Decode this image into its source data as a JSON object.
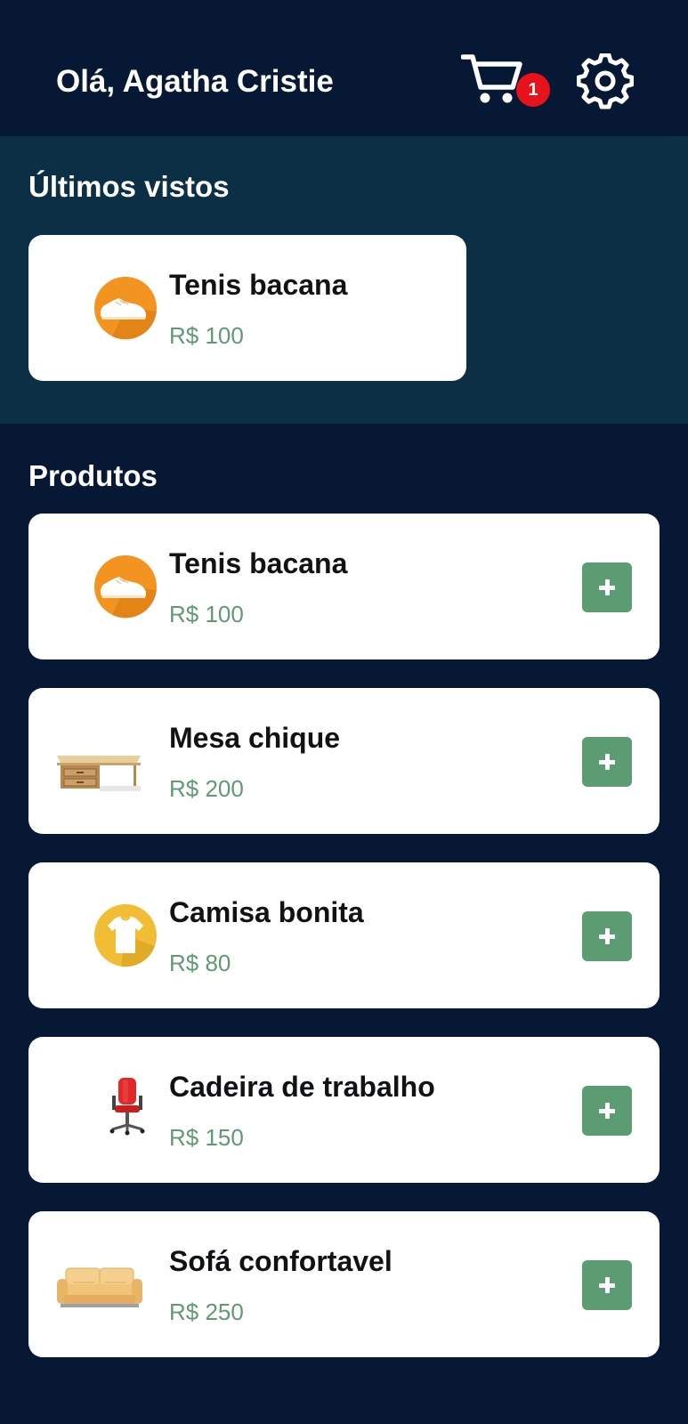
{
  "header": {
    "greeting": "Olá, Agatha Cristie",
    "cart_count": "1",
    "cart_icon": "cart-icon",
    "settings_icon": "gear-icon"
  },
  "recent": {
    "title": "Últimos vistos",
    "items": [
      {
        "name": "Tenis bacana",
        "price": "R$ 100",
        "icon": "sneaker-icon"
      }
    ]
  },
  "products": {
    "title": "Produtos",
    "items": [
      {
        "name": "Tenis bacana",
        "price": "R$ 100",
        "icon": "sneaker-icon"
      },
      {
        "name": "Mesa chique",
        "price": "R$ 200",
        "icon": "desk-icon"
      },
      {
        "name": "Camisa bonita",
        "price": "R$ 80",
        "icon": "tshirt-icon"
      },
      {
        "name": "Cadeira de trabalho",
        "price": "R$ 150",
        "icon": "office-chair-icon"
      },
      {
        "name": "Sofá confortavel",
        "price": "R$ 250",
        "icon": "sofa-icon"
      }
    ]
  },
  "colors": {
    "background": "#061833",
    "recent_background": "#0b2f45",
    "price": "#5f9a72",
    "add_button": "#5c9c72",
    "badge": "#e8121c"
  }
}
